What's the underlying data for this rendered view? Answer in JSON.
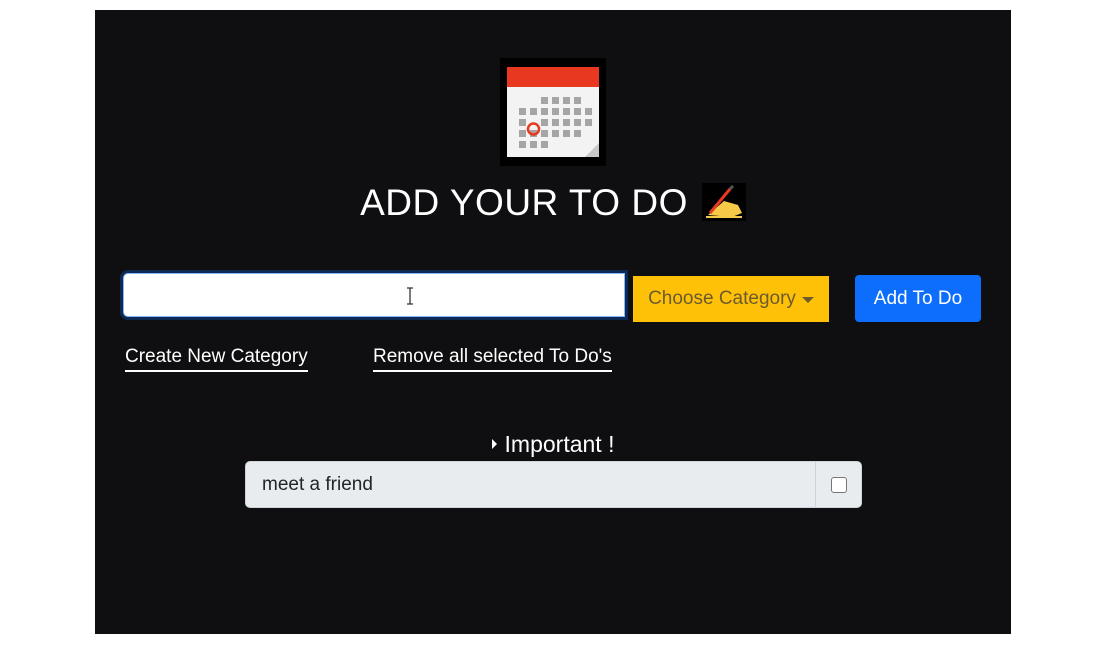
{
  "header": {
    "logo_icon": "calendar-icon",
    "title": "ADD YOUR TO DO",
    "title_icon": "writing-hand-icon"
  },
  "form": {
    "todo_input_value": "",
    "category_label": "Choose Category",
    "add_button_label": "Add To Do"
  },
  "links": {
    "create_category": "Create New Category",
    "remove_selected": "Remove all selected To Do's"
  },
  "groups": [
    {
      "name": "Important !",
      "expanded": false,
      "items": [
        {
          "text": "meet a friend",
          "checked": false
        }
      ]
    }
  ],
  "colors": {
    "background": "#0f0f11",
    "category_button": "#ffc107",
    "add_button": "#0d6efd",
    "todo_row": "#e9ecef"
  }
}
